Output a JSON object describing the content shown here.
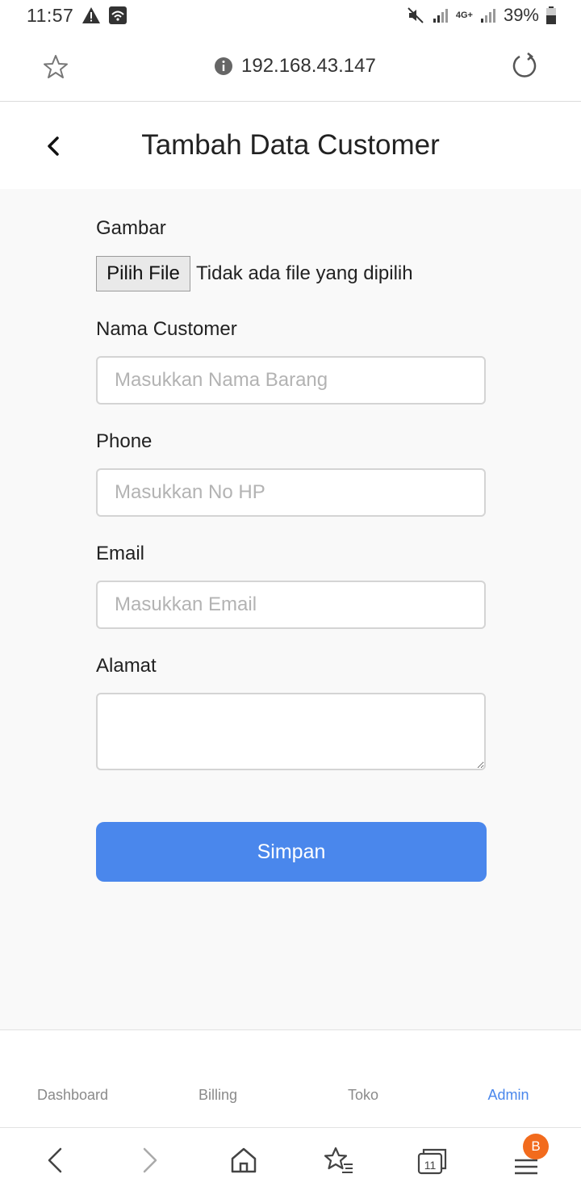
{
  "status_bar": {
    "time": "11:57",
    "network_label": "4G+",
    "battery": "39%"
  },
  "address_bar": {
    "url": "192.168.43.147"
  },
  "header": {
    "title": "Tambah Data Customer"
  },
  "form": {
    "gambar_label": "Gambar",
    "file_button_label": "Pilih File",
    "file_status": "Tidak ada file yang dipilih",
    "nama_label": "Nama Customer",
    "nama_placeholder": "Masukkan Nama Barang",
    "phone_label": "Phone",
    "phone_placeholder": "Masukkan No HP",
    "email_label": "Email",
    "email_placeholder": "Masukkan Email",
    "alamat_label": "Alamat",
    "submit_label": "Simpan"
  },
  "app_nav": {
    "items": [
      "Dashboard",
      "Billing",
      "Toko",
      "Admin"
    ],
    "active": "Admin"
  },
  "browser_toolbar": {
    "tabs_count": "11",
    "menu_badge": "B"
  },
  "colors": {
    "accent": "#4a87ec",
    "badge": "#f26b1d"
  }
}
